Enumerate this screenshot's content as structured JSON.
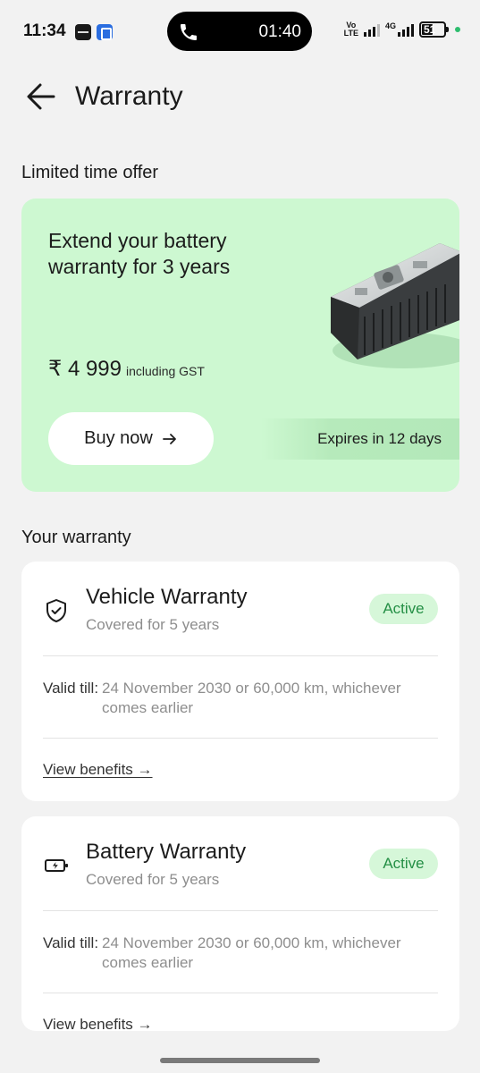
{
  "status_bar": {
    "time": "11:34",
    "call_timer": "01:40",
    "volte_top": "Vo",
    "volte_bottom": "LTE",
    "network": "4G",
    "battery_level": "51",
    "app_icons": [
      "app-notification-icon",
      "phone-app-icon"
    ]
  },
  "header": {
    "title": "Warranty",
    "back_icon": "arrow-left-icon"
  },
  "offer": {
    "section_title": "Limited time offer",
    "headline": "Extend your battery warranty for 3 years",
    "price": "₹ 4 999",
    "price_note": "including GST",
    "buy_label": "Buy now",
    "buy_icon": "arrow-right-icon",
    "expires": "Expires in 12 days",
    "background": "#cdf8d1"
  },
  "warranty": {
    "section_title": "Your warranty",
    "cards": [
      {
        "icon": "shield-check-icon",
        "title": "Vehicle Warranty",
        "subtitle": "Covered for 5 years",
        "status": "Active",
        "valid_label": "Valid till:",
        "valid_value": "24 November 2030 or 60,000 km, whichever comes earlier",
        "link": "View benefits →"
      },
      {
        "icon": "battery-charging-icon",
        "title": "Battery Warranty",
        "subtitle": "Covered for 5 years",
        "status": "Active",
        "valid_label": "Valid till:",
        "valid_value": "24 November 2030 or 60,000 km, whichever comes earlier",
        "link": "View benefits →"
      }
    ]
  },
  "colors": {
    "accent_green_bg": "#d6f7d9",
    "accent_green_text": "#248f45",
    "page_bg": "#f2f2f2"
  }
}
